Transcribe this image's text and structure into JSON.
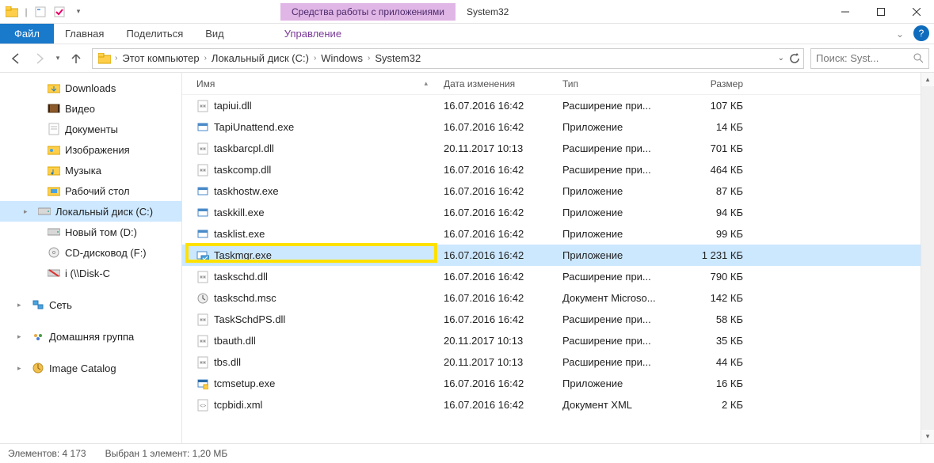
{
  "titlebar": {
    "context_label": "Средства работы с приложениями",
    "window_title": "System32"
  },
  "ribbon": {
    "file": "Файл",
    "tabs": [
      "Главная",
      "Поделиться",
      "Вид"
    ],
    "context_tab": "Управление"
  },
  "breadcrumb": [
    "Этот компьютер",
    "Локальный диск (C:)",
    "Windows",
    "System32"
  ],
  "search": {
    "placeholder": "Поиск: Syst..."
  },
  "sidebar": {
    "items": [
      {
        "icon": "downloads",
        "label": "Downloads",
        "indent": 1
      },
      {
        "icon": "video",
        "label": "Видео",
        "indent": 1
      },
      {
        "icon": "documents",
        "label": "Документы",
        "indent": 1
      },
      {
        "icon": "pictures",
        "label": "Изображения",
        "indent": 1
      },
      {
        "icon": "music",
        "label": "Музыка",
        "indent": 1
      },
      {
        "icon": "desktop",
        "label": "Рабочий стол",
        "indent": 1
      },
      {
        "icon": "disk",
        "label": "Локальный диск (C:)",
        "indent": 1,
        "selected": true,
        "caret": true
      },
      {
        "icon": "disk",
        "label": "Новый том (D:)",
        "indent": 1
      },
      {
        "icon": "cd",
        "label": "CD-дисковод (F:)",
        "indent": 1
      },
      {
        "icon": "net-off",
        "label": "i (\\\\Disk-C",
        "indent": 1
      }
    ],
    "groups": [
      {
        "icon": "network",
        "label": "Сеть"
      },
      {
        "icon": "homegroup",
        "label": "Домашняя группа"
      },
      {
        "icon": "catalog",
        "label": "Image Catalog"
      }
    ]
  },
  "columns": {
    "name": "Имя",
    "date": "Дата изменения",
    "type": "Тип",
    "size": "Размер"
  },
  "files": [
    {
      "icon": "dll",
      "name": "tapiui.dll",
      "date": "16.07.2016 16:42",
      "type": "Расширение при...",
      "size": "107 КБ"
    },
    {
      "icon": "exe",
      "name": "TapiUnattend.exe",
      "date": "16.07.2016 16:42",
      "type": "Приложение",
      "size": "14 КБ"
    },
    {
      "icon": "dll",
      "name": "taskbarcpl.dll",
      "date": "20.11.2017 10:13",
      "type": "Расширение при...",
      "size": "701 КБ"
    },
    {
      "icon": "dll",
      "name": "taskcomp.dll",
      "date": "16.07.2016 16:42",
      "type": "Расширение при...",
      "size": "464 КБ"
    },
    {
      "icon": "exe",
      "name": "taskhostw.exe",
      "date": "16.07.2016 16:42",
      "type": "Приложение",
      "size": "87 КБ"
    },
    {
      "icon": "exe",
      "name": "taskkill.exe",
      "date": "16.07.2016 16:42",
      "type": "Приложение",
      "size": "94 КБ"
    },
    {
      "icon": "exe",
      "name": "tasklist.exe",
      "date": "16.07.2016 16:42",
      "type": "Приложение",
      "size": "99 КБ"
    },
    {
      "icon": "taskmgr",
      "name": "Taskmgr.exe",
      "date": "16.07.2016 16:42",
      "type": "Приложение",
      "size": "1 231 КБ",
      "selected": true,
      "highlight": true
    },
    {
      "icon": "dll",
      "name": "taskschd.dll",
      "date": "16.07.2016 16:42",
      "type": "Расширение при...",
      "size": "790 КБ"
    },
    {
      "icon": "msc",
      "name": "taskschd.msc",
      "date": "16.07.2016 16:42",
      "type": "Документ Microso...",
      "size": "142 КБ"
    },
    {
      "icon": "dll",
      "name": "TaskSchdPS.dll",
      "date": "16.07.2016 16:42",
      "type": "Расширение при...",
      "size": "58 КБ"
    },
    {
      "icon": "dll",
      "name": "tbauth.dll",
      "date": "20.11.2017 10:13",
      "type": "Расширение при...",
      "size": "35 КБ"
    },
    {
      "icon": "dll",
      "name": "tbs.dll",
      "date": "20.11.2017 10:13",
      "type": "Расширение при...",
      "size": "44 КБ"
    },
    {
      "icon": "exe-b",
      "name": "tcmsetup.exe",
      "date": "16.07.2016 16:42",
      "type": "Приложение",
      "size": "16 КБ"
    },
    {
      "icon": "xml",
      "name": "tcpbidi.xml",
      "date": "16.07.2016 16:42",
      "type": "Документ XML",
      "size": "2 КБ"
    }
  ],
  "status": {
    "count_label": "Элементов:",
    "count": "4 173",
    "sel_label": "Выбран 1 элемент:",
    "sel_size": "1,20 МБ"
  }
}
